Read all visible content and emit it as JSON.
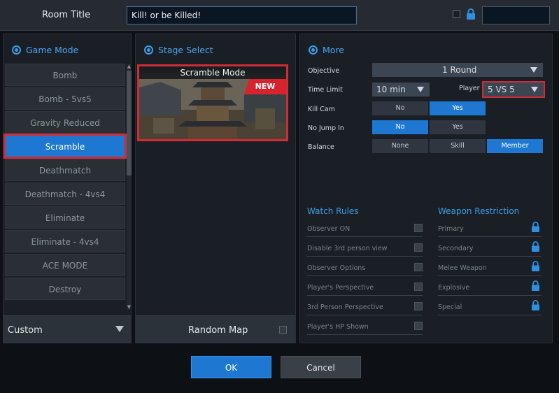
{
  "header": {
    "room_label": "Room Title",
    "room_title_value": "Kill! or be Killed!"
  },
  "game_mode": {
    "title": "Game Mode",
    "items": [
      "Bomb",
      "Bomb - 5vs5",
      "Gravity Reduced",
      "Scramble",
      "Deathmatch",
      "Deathmatch - 4vs4",
      "Eliminate",
      "Eliminate - 4vs4",
      "ACE MODE",
      "Destroy"
    ],
    "selected": "Scramble",
    "filter_value": "Custom"
  },
  "stage_select": {
    "title": "Stage Select",
    "map_name": "Scramble Mode",
    "badge": "NEW",
    "random_map_label": "Random Map"
  },
  "more": {
    "title": "More",
    "objective_label": "Objective",
    "objective_value": "1 Round",
    "time_limit_label": "Time Limit",
    "time_limit_value": "10 min",
    "player_label": "Player",
    "player_value": "5 VS 5",
    "kill_cam_label": "Kill Cam",
    "kill_cam_options": [
      "No",
      "Yes"
    ],
    "kill_cam_selected": "Yes",
    "no_jump_label": "No Jump In",
    "no_jump_options": [
      "No",
      "Yes"
    ],
    "no_jump_selected": "No",
    "balance_label": "Balance",
    "balance_options": [
      "None",
      "Skill",
      "Member"
    ],
    "balance_selected": "Member"
  },
  "watch_rules": {
    "title": "Watch Rules",
    "items": [
      "Observer ON",
      "Disable 3rd person view",
      "Observer Options",
      "Player's Perspective",
      "3rd Person Perspective",
      "Player's HP Shown"
    ]
  },
  "weapon_restriction": {
    "title": "Weapon Restriction",
    "items": [
      "Primary",
      "Secondary",
      "Melee Weapon",
      "Explosive",
      "Special"
    ]
  },
  "buttons": {
    "ok": "OK",
    "cancel": "Cancel"
  },
  "colors": {
    "accent": "#1e78d2",
    "highlight": "#d12b35",
    "title_blue": "#4aa8f0"
  }
}
